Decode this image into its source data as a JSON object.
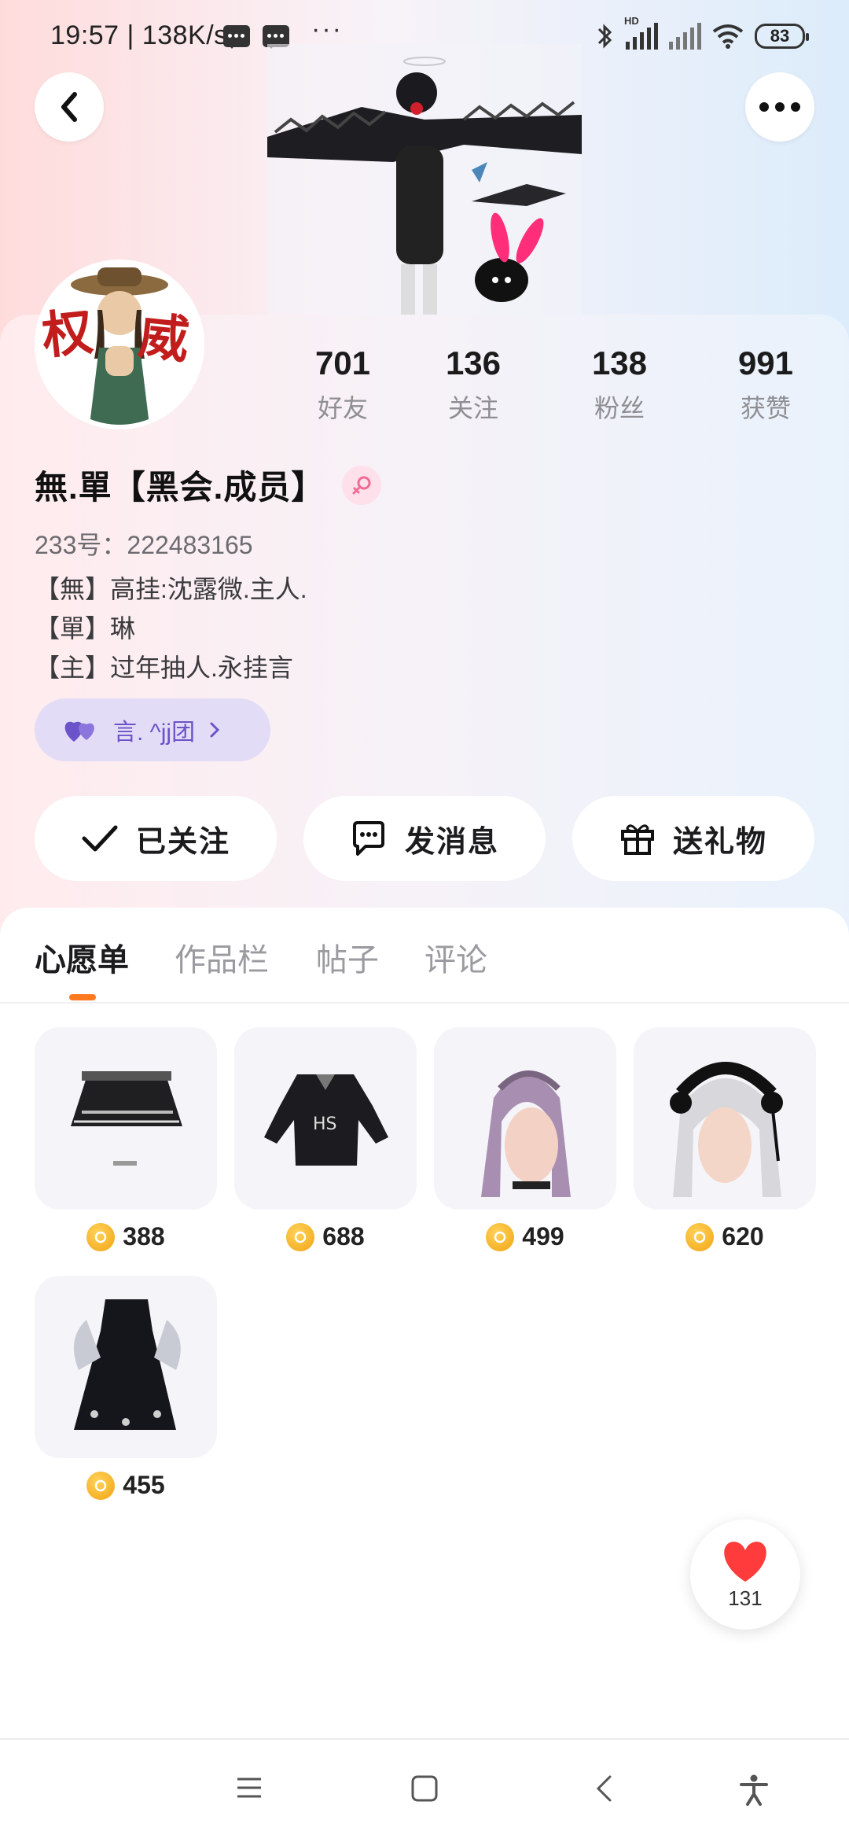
{
  "status_bar": {
    "time_speed": "19:57 | 138K/s",
    "battery": "83",
    "overflow": "···"
  },
  "header": {
    "back_icon": "chevron-left-icon",
    "more_icon": "more-dots-icon"
  },
  "stats": [
    {
      "value": "701",
      "label": "好友"
    },
    {
      "value": "136",
      "label": "关注"
    },
    {
      "value": "138",
      "label": "粉丝"
    },
    {
      "value": "991",
      "label": "获赞"
    }
  ],
  "profile": {
    "avatar_text": "权威",
    "name": "無.單【黑会.成员】",
    "gender_icon": "female-icon",
    "uid": "233号：222483165",
    "bio": [
      "【無】高挂:沈露微.主人.",
      "【單】琳",
      "【主】过年抽人.永挂言"
    ],
    "group": "言. ^jj团"
  },
  "actions": {
    "follow": "已关注",
    "message": "发消息",
    "gift": "送礼物"
  },
  "tabs": [
    {
      "label": "心愿单",
      "active": true
    },
    {
      "label": "作品栏",
      "active": false
    },
    {
      "label": "帖子",
      "active": false
    },
    {
      "label": "评论",
      "active": false
    }
  ],
  "wishlist": [
    {
      "item": "pleated black skirt",
      "price": "388"
    },
    {
      "item": "black jacket",
      "price": "688"
    },
    {
      "item": "purple twin-tail hair",
      "price": "499"
    },
    {
      "item": "silver hair with maid headband",
      "price": "620"
    },
    {
      "item": "dark dress",
      "price": "455"
    }
  ],
  "like": {
    "count": "131",
    "color": "#ff3b3b"
  },
  "nav_icons": [
    "menu-icon",
    "home-square-icon",
    "back-triangle-icon",
    "accessibility-icon"
  ],
  "colors": {
    "accent": "#ff7a1f",
    "group_chip_text": "#6b54c9",
    "coin": "#f1a313"
  }
}
